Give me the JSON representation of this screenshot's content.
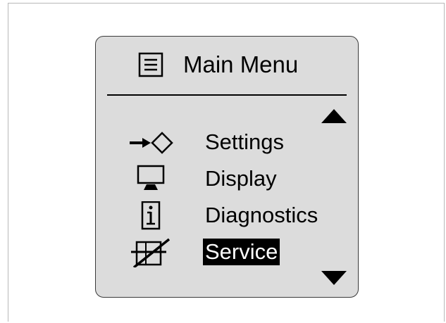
{
  "menu": {
    "title": "Main Menu",
    "title_icon": "menu-list-icon",
    "scroll_up_icon": "triangle-up-icon",
    "scroll_down_icon": "triangle-down-icon",
    "items": [
      {
        "label": "Settings",
        "icon": "login-arrow-diamond-icon",
        "selected": false
      },
      {
        "label": "Display",
        "icon": "monitor-icon",
        "selected": false
      },
      {
        "label": "Diagnostics",
        "icon": "info-icon",
        "selected": false
      },
      {
        "label": "Service",
        "icon": "cabinet-service-icon",
        "selected": true
      }
    ]
  },
  "colors": {
    "screen_background": "#dcdcdc",
    "text": "#000000",
    "selected_background": "#000000",
    "selected_text": "#ffffff"
  }
}
